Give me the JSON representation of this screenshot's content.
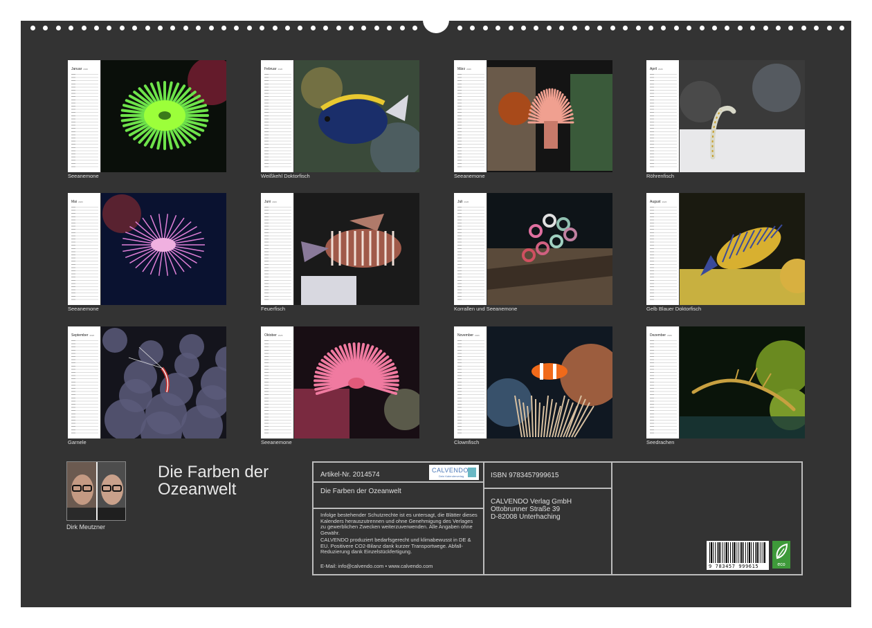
{
  "months": [
    {
      "name": "Januar",
      "year": "2026",
      "caption": "Seeanemone",
      "scene": "green-anemone"
    },
    {
      "name": "Februar",
      "year": "2026",
      "caption": "Weißkehl Doktorfisch",
      "scene": "blue-tang"
    },
    {
      "name": "März",
      "year": "2026",
      "caption": "Seeanemone",
      "scene": "pink-anemone-rock"
    },
    {
      "name": "April",
      "year": "2026",
      "caption": "Röhrenfisch",
      "scene": "garden-eel"
    },
    {
      "name": "Mai",
      "year": "2026",
      "caption": "Seeanemone",
      "scene": "purple-anemone"
    },
    {
      "name": "Juni",
      "year": "2026",
      "caption": "Feuerfisch",
      "scene": "lionfish"
    },
    {
      "name": "Juli",
      "year": "2026",
      "caption": "Korrallen und Seeanemone",
      "scene": "corals"
    },
    {
      "name": "August",
      "year": "2026",
      "caption": "Gelb Blauer Doktorfisch",
      "scene": "striped-tang"
    },
    {
      "name": "September",
      "year": "2026",
      "caption": "Garnele",
      "scene": "shrimp"
    },
    {
      "name": "Oktober",
      "year": "2026",
      "caption": "Seeanemone",
      "scene": "red-anemone"
    },
    {
      "name": "November",
      "year": "2026",
      "caption": "Clownfisch",
      "scene": "clownfish"
    },
    {
      "name": "Dezember",
      "year": "2026",
      "caption": "Seedrachen",
      "scene": "seadragon"
    }
  ],
  "author": {
    "name": "Dirk Meutzner"
  },
  "title": "Die Farben der Ozeanwelt",
  "info": {
    "article": "Artikel-Nr. 2014574",
    "product_title": "Die Farben der Ozeanwelt",
    "legal": "Infolge bestehender Schutzrechte ist es untersagt, die Blätter dieses Kalenders herauszutrennen und ohne Genehmigung des Verlages zu gewerblichen Zwecken weiterzuverwenden. Alle Angaben ohne Gewähr.",
    "eco_note": "CALVENDO produziert bedarfsgerecht und klimabewusst in DE & EU. Positivere CO2-Bilanz dank kurzer Transportwege. Abfall-Reduzierung dank Einzelstückfertigung.",
    "contact": "E-Mail: info@calvendo.com • www.calvendo.com",
    "isbn": "ISBN 9783457999615",
    "publisher_name": "CALVENDO Verlag GmbH",
    "publisher_street": "Ottobrunner Straße 39",
    "publisher_city": "D-82008 Unterhaching",
    "logo_name": "CALVENDO",
    "logo_sub": "Dein Kalenderverlag",
    "barcode_number": "9 783457 999615",
    "eco_label": "eco"
  },
  "colors": {
    "background": "#333333",
    "border": "#bdbdbd",
    "calvendo_blue": "#4a77b8",
    "eco_green": "#3e9a3a"
  }
}
